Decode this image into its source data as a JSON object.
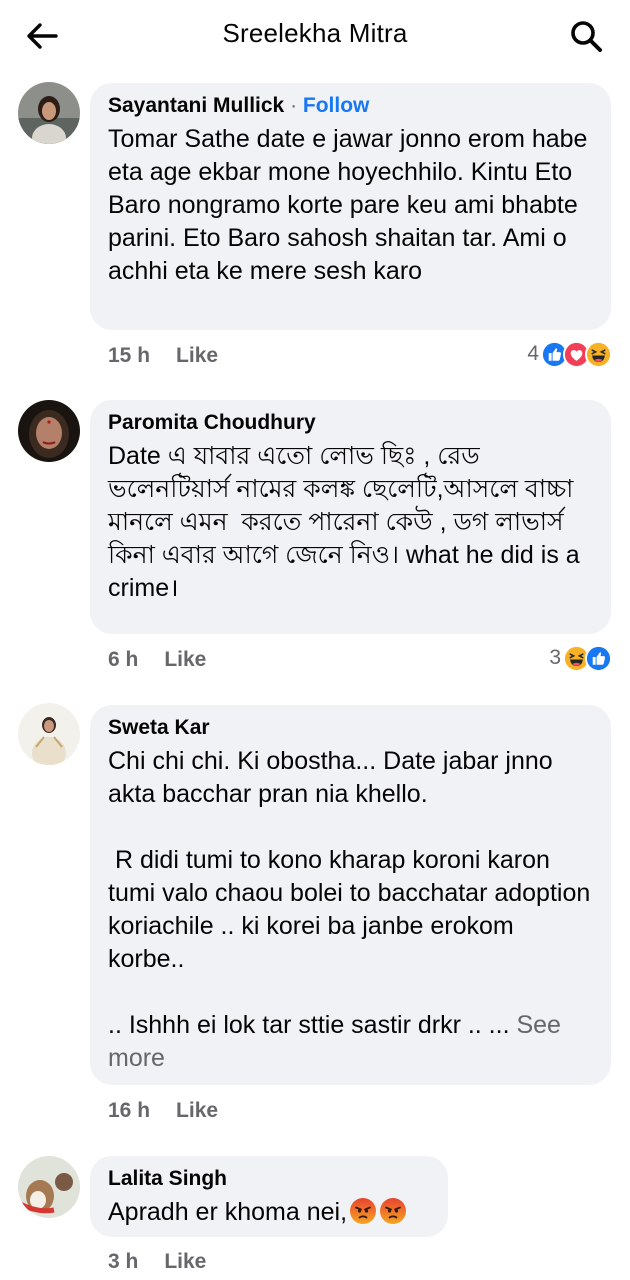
{
  "header": {
    "title": "Sreelekha Mitra"
  },
  "comments": [
    {
      "author": "Sayantani Mullick",
      "separator": " · ",
      "follow_label": "Follow",
      "text": "Tomar Sathe date e jawar jonno erom habe eta age ekbar mone hoyechhilo. Kintu Eto Baro nongramo korte pare keu ami bhabte parini. Eto Baro sahosh shaitan tar. Ami o achhi eta ke mere sesh karo",
      "time": "15 h",
      "like_label": "Like",
      "reaction_count": "4",
      "reactions": [
        "like-icon",
        "love-icon",
        "haha-icon"
      ]
    },
    {
      "author": "Paromita Choudhury",
      "text": "Date এ যাবার এতো লোভ ছিঃ , রেড ভলেনটিয়ার্স নামের কলঙ্ক ছেলেটি,আসলে বাচ্চা মানলে এমন  করতে পারেনা কেউ , ডগ লাভার্স  কিনা এবার আগে জেনে নিও। what he did is a crime।",
      "time": "6 h",
      "like_label": "Like",
      "reaction_count": "3",
      "reactions": [
        "haha-icon",
        "like-icon"
      ]
    },
    {
      "author": "Sweta Kar",
      "text": "Chi chi chi. Ki obostha... Date jabar jnno akta bacchar pran nia khello.\n\n R didi tumi to kono kharap koroni karon tumi valo chaou bolei to bacchatar adoption koriachile .. ki korei ba janbe erokom korbe..\n\n.. Ishhh ei lok tar sttie sastir drkr .. ...",
      "see_more": "See more",
      "time": "16 h",
      "like_label": "Like"
    },
    {
      "author": "Lalita Singh",
      "text": "Apradh er khoma nei,",
      "inline_emojis": [
        "angry-emoji",
        "angry-emoji"
      ],
      "time": "3 h",
      "like_label": "Like"
    }
  ]
}
